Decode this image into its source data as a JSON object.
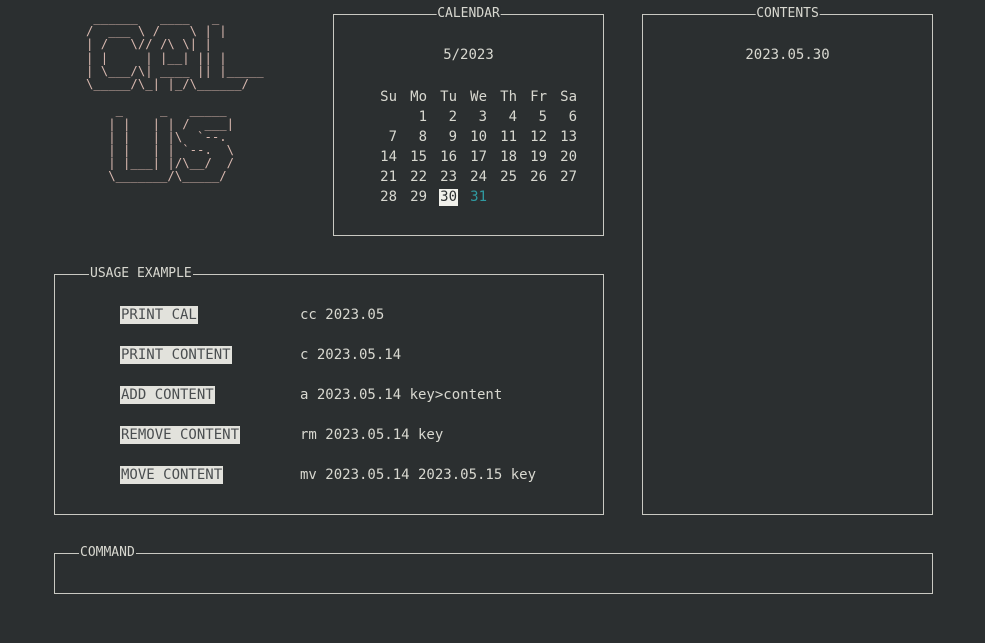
{
  "logo": {
    "art": " ______   ____   _\n/  ___ \\ /    \\ | |\n| /   \\// /\\ \\| |\n| |     | |__| || |\n| \\___/\\| ____ || |_____\n\\_____/\\_| |_/\\______/\n\n    _     _   _____\n   | |   | | /  ___|\n   | |   | |\\  `--.\n   | |   | | `--.  \\\n   | |___| |/\\__/  /\n   \\_______/\\_____/"
  },
  "calendar": {
    "title": "CALENDAR",
    "month": "5/2023",
    "headers": [
      "Su",
      "Mo",
      "Tu",
      "We",
      "Th",
      "Fr",
      "Sa"
    ],
    "weeks": [
      [
        "",
        "1",
        "2",
        "3",
        "4",
        "5",
        "6"
      ],
      [
        "7",
        "8",
        "9",
        "10",
        "11",
        "12",
        "13"
      ],
      [
        "14",
        "15",
        "16",
        "17",
        "18",
        "19",
        "20"
      ],
      [
        "21",
        "22",
        "23",
        "24",
        "25",
        "26",
        "27"
      ],
      [
        "28",
        "29",
        "30",
        "31",
        "",
        "",
        ""
      ]
    ],
    "today": "30",
    "highlight_color": "#2f9aa0"
  },
  "contents": {
    "title": "CONTENTS",
    "items": [
      "2023.05.30"
    ]
  },
  "usage": {
    "title": "USAGE EXAMPLE",
    "rows": [
      {
        "label": "PRINT CAL",
        "command": "cc 2023.05"
      },
      {
        "label": "PRINT CONTENT",
        "command": "c 2023.05.14"
      },
      {
        "label": "ADD CONTENT",
        "command": "a 2023.05.14 key>content"
      },
      {
        "label": "REMOVE CONTENT",
        "command": "rm 2023.05.14 key"
      },
      {
        "label": "MOVE CONTENT",
        "command": "mv 2023.05.14 2023.05.15 key"
      }
    ]
  },
  "command": {
    "title": "COMMAND",
    "value": ""
  }
}
